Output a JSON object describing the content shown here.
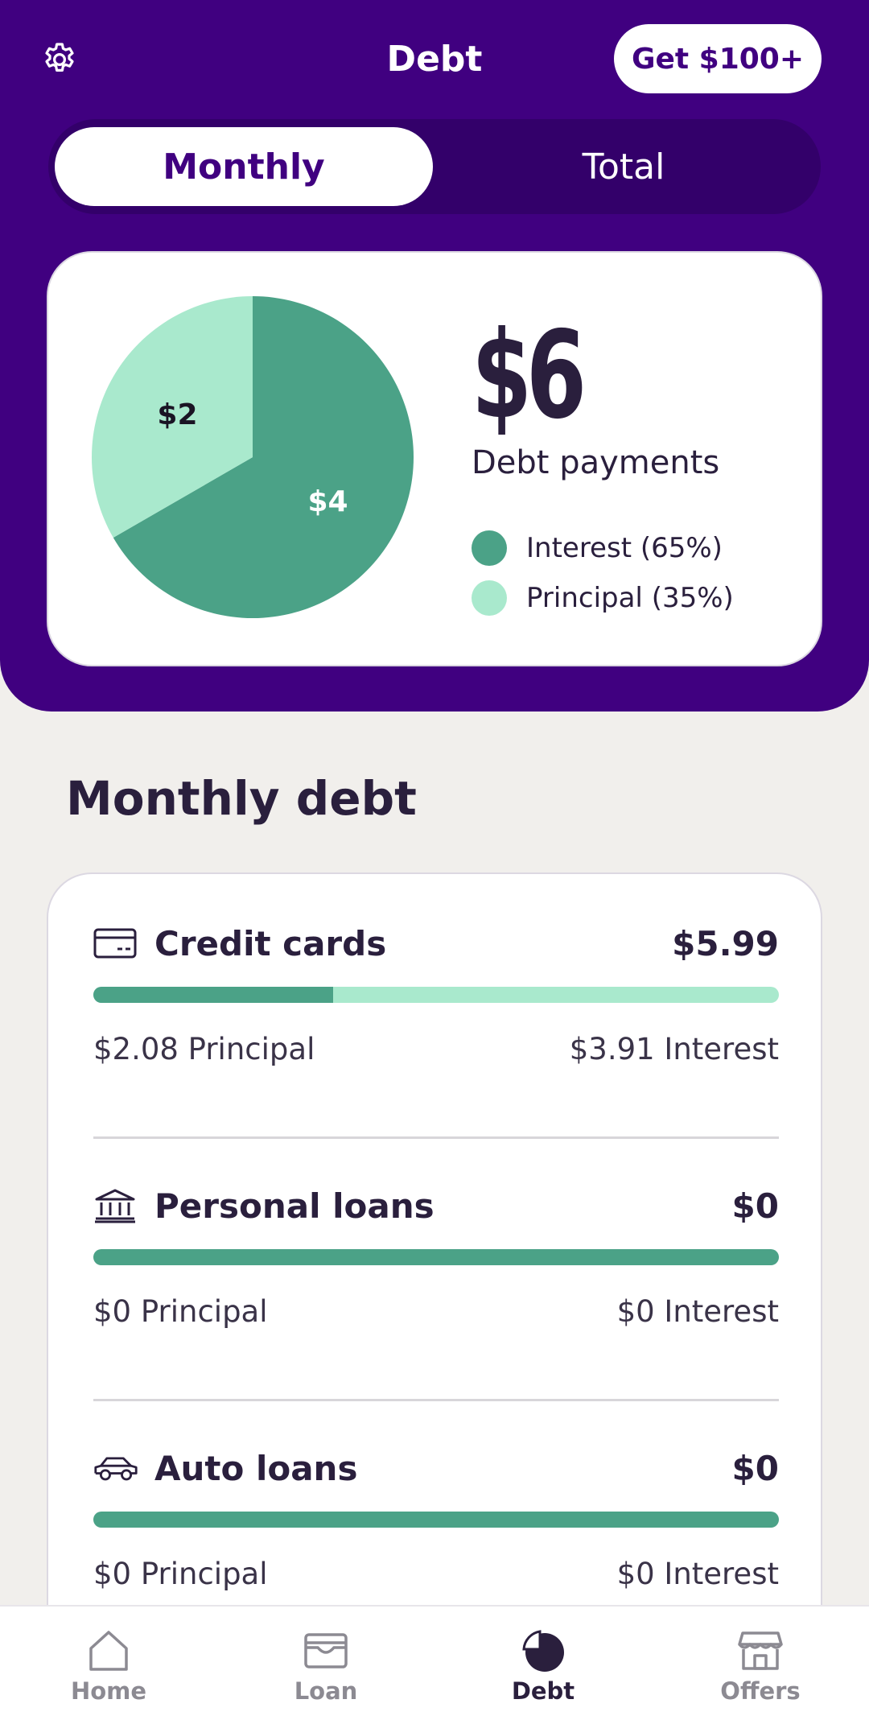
{
  "header": {
    "title": "Debt",
    "cta_label": "Get $100+",
    "tabs": [
      {
        "label": "Monthly",
        "active": true
      },
      {
        "label": "Total",
        "active": false
      }
    ]
  },
  "summary": {
    "amount": "$6",
    "amount_label": "Debt payments",
    "legend": [
      {
        "label": "Interest (65%)",
        "color": "#4ba287"
      },
      {
        "label": "Principal (35%)",
        "color": "#a9e9cd"
      }
    ]
  },
  "chart_data": {
    "type": "pie",
    "slices": [
      {
        "label": "Interest",
        "value": 4,
        "display": "$4",
        "color": "#4ba287"
      },
      {
        "label": "Principal",
        "value": 2,
        "display": "$2",
        "color": "#a9e9cd"
      }
    ]
  },
  "section_title": "Monthly debt",
  "debts": [
    {
      "name": "Credit cards",
      "icon": "credit-card-icon",
      "amount": "$5.99",
      "principal_label": "$2.08 Principal",
      "interest_label": "$3.91 Interest",
      "principal_fraction": 0.35
    },
    {
      "name": "Personal loans",
      "icon": "bank-icon",
      "amount": "$0",
      "principal_label": "$0 Principal",
      "interest_label": "$0 Interest",
      "principal_fraction": 1.0
    },
    {
      "name": "Auto loans",
      "icon": "car-icon",
      "amount": "$0",
      "principal_label": "$0 Principal",
      "interest_label": "$0 Interest",
      "principal_fraction": 1.0
    }
  ],
  "nav": [
    {
      "label": "Home",
      "icon": "home-icon",
      "active": false
    },
    {
      "label": "Loan",
      "icon": "wallet-icon",
      "active": false
    },
    {
      "label": "Debt",
      "icon": "pie-chart-icon",
      "active": true
    },
    {
      "label": "Offers",
      "icon": "store-icon",
      "active": false
    }
  ],
  "colors": {
    "brand": "#400080",
    "interest": "#4ba287",
    "principal": "#a9e9cd"
  }
}
